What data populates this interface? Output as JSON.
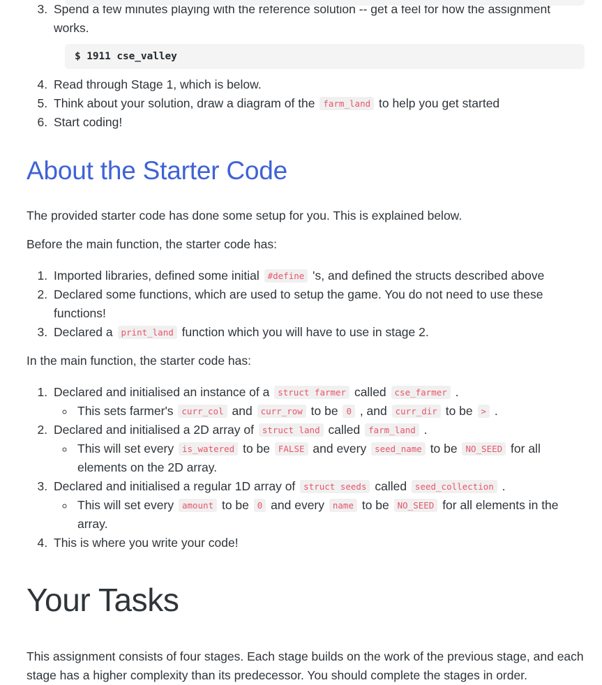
{
  "document": {
    "clipped_codeblock_above": "",
    "setup_list": {
      "start": 3,
      "items": [
        {
          "text": "Spend a few minutes playing with the reference solution -- get a feel for how the assignment works."
        },
        {
          "text": "Read through Stage 1, which is below."
        },
        {
          "text_before": "Think about your solution, draw a diagram of the ",
          "code": "farm_land",
          "text_after": " to help you get started"
        },
        {
          "text": "Start coding!"
        }
      ]
    },
    "terminal_command": "$ 1911 cse_valley",
    "starter_code_section": {
      "heading": "About the Starter Code",
      "intro_paragraph": "The provided starter code has done some setup for you. This is explained below.",
      "before_main_label": "Before the main function, the starter code has:",
      "before_main_items": [
        {
          "part1": "Imported libraries, defined some initial ",
          "code1": "#define",
          "part2": " 's, and defined the structs described above"
        },
        {
          "part1": "Declared some functions, which are used to setup the game. You do not need to use these functions!",
          "code1": "",
          "part2": ""
        },
        {
          "part1": "Declared a ",
          "code1": "print_land",
          "part2": " function which you will have to use in stage 2."
        }
      ],
      "in_main_label": "In the main function, the starter code has:",
      "in_main_items": [
        {
          "part1": "Declared and initialised an instance of a ",
          "code1": "struct farmer",
          "part2": " called ",
          "code2": "cse_farmer",
          "part3": " .",
          "sub": {
            "s1": "This sets farmer's ",
            "c1": "curr_col",
            "s2": " and ",
            "c2": "curr_row",
            "s3": " to be ",
            "c3": "0",
            "s4": " , and ",
            "c4": "curr_dir",
            "s5": " to be ",
            "c5": ">",
            "s6": " ."
          }
        },
        {
          "part1": "Declared and initialised a 2D array of ",
          "code1": "struct land",
          "part2": " called ",
          "code2": "farm_land",
          "part3": " .",
          "sub": {
            "s1": "This will set every ",
            "c1": "is_watered",
            "s2": " to be ",
            "c2": "FALSE",
            "s3": " and every ",
            "c3": "seed_name",
            "s4": " to be ",
            "c4": "NO_SEED",
            "s5": " for all elements on the 2D array.",
            "s6": ""
          }
        },
        {
          "part1": "Declared and initialised a regular 1D array of ",
          "code1": "struct seeds",
          "part2": " called ",
          "code2": "seed_collection",
          "part3": " .",
          "sub": {
            "s1": "This will set every ",
            "c1": "amount",
            "s2": " to be ",
            "c2": "0",
            "s3": " and every ",
            "c3": "name",
            "s4": " to be ",
            "c4": "NO_SEED",
            "s5": " for all elements in the array.",
            "s6": ""
          }
        },
        {
          "part1": "This is where you write your code!",
          "code1": "",
          "part2": "",
          "code2": "",
          "part3": ""
        }
      ]
    },
    "tasks_section": {
      "heading": "Your Tasks",
      "paragraph": "This assignment consists of four stages. Each stage builds on the work of the previous stage, and each stage has a higher complexity than its predecessor. You should complete the stages in order."
    }
  },
  "colors": {
    "heading_blue": "#3f62d6",
    "inline_code_text": "#e8556a",
    "inline_code_bg": "#f0f0f0",
    "codeblock_bg": "#f4f4f4",
    "body_text": "#2f3439"
  }
}
